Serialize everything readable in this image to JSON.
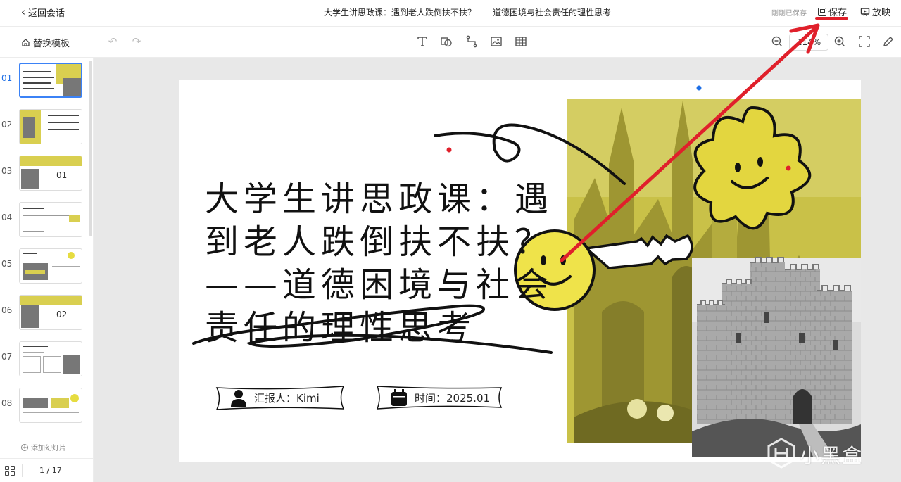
{
  "topbar": {
    "back_label": "返回会话",
    "doc_title": "大学生讲思政课：遇到老人跌倒扶不扶？——道德困境与社会责任的理性思考",
    "saved_status": "刚刚已保存",
    "save_label": "保存",
    "play_label": "放映"
  },
  "toolbar": {
    "template_label": "替换模板",
    "zoom_value": "114%"
  },
  "sidebar": {
    "slides": [
      {
        "num": "01"
      },
      {
        "num": "02"
      },
      {
        "num": "03"
      },
      {
        "num": "04"
      },
      {
        "num": "05"
      },
      {
        "num": "06"
      },
      {
        "num": "07"
      },
      {
        "num": "08"
      }
    ],
    "add_slide_label": "添加幻灯片",
    "page_counter": "1 / 17"
  },
  "slide": {
    "title": "大学生讲思政课：遇到老人跌倒扶不扶？——道德困境与社会责任的理性思考",
    "reporter_text": "汇报人：Kimi",
    "time_text": "时间：2025.01"
  },
  "colors": {
    "accent_yellow": "#d9cf50",
    "annotation_red": "#e0202b",
    "active_blue": "#3b82f6"
  },
  "watermark_text": "小黑盒"
}
